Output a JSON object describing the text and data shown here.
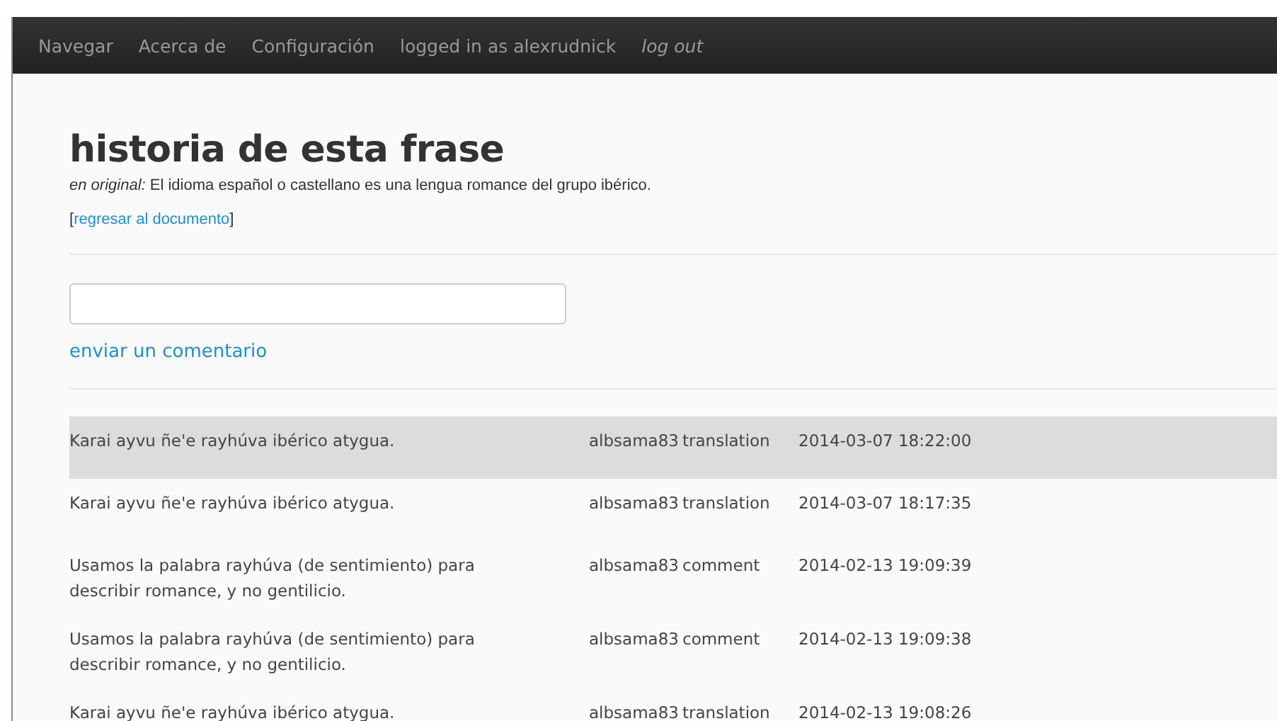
{
  "navbar": {
    "items": [
      {
        "label": "Navegar",
        "kind": "link"
      },
      {
        "label": "Acerca de",
        "kind": "link"
      },
      {
        "label": "Configuración",
        "kind": "link"
      },
      {
        "label": "logged in as alexrudnick",
        "kind": "text"
      },
      {
        "label": "log out",
        "kind": "logout"
      }
    ]
  },
  "title": "historia de esta frase",
  "original": {
    "label": "en original:",
    "text": "El idioma español o castellano es una lengua romance del grupo ibérico."
  },
  "back_link": {
    "open": "[",
    "label": "regresar al documento",
    "close": "]"
  },
  "comment": {
    "submit": "enviar un comentario"
  },
  "history": [
    {
      "text": "Karai ayvu ñe'e rayhúva ibérico atygua.",
      "user": "albsama83",
      "type": "translation",
      "date": "2014-03-07 18:22:00",
      "highlighted": true
    },
    {
      "text": "Karai ayvu ñe'e rayhúva ibérico atygua.",
      "user": "albsama83",
      "type": "translation",
      "date": "2014-03-07 18:17:35",
      "highlighted": false
    },
    {
      "text": "Usamos la palabra rayhúva (de sentimiento) para describir romance, y no gentilicio.",
      "user": "albsama83",
      "type": "comment",
      "date": "2014-02-13 19:09:39",
      "highlighted": false
    },
    {
      "text": "Usamos la palabra rayhúva (de sentimiento) para describir romance, y no gentilicio.",
      "user": "albsama83",
      "type": "comment",
      "date": "2014-02-13 19:09:38",
      "highlighted": false
    },
    {
      "text": "Karai ayvu ñe'e rayhúva ibérico atygua.",
      "user": "albsama83",
      "type": "translation",
      "date": "2014-02-13 19:08:26",
      "highlighted": false
    }
  ]
}
